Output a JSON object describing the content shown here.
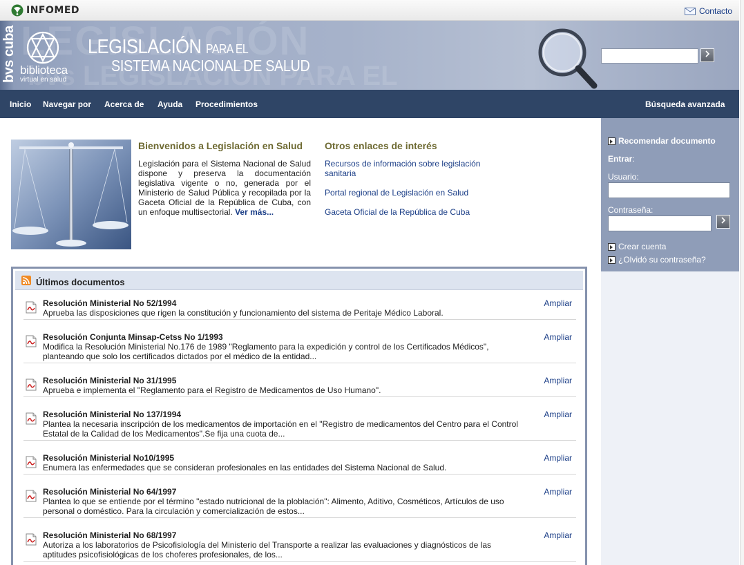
{
  "topbar": {
    "brand": "INFOMED",
    "contact_label": "Contacto"
  },
  "banner": {
    "bvs_label": "bvs cuba",
    "library_name": "biblioteca",
    "library_sub": "virtual en salud",
    "title_main": "LEGISLACIÓN",
    "title_small": "PARA EL",
    "title_sub": "SISTEMA NACIONAL DE SALUD",
    "search_value": ""
  },
  "nav": {
    "items": [
      "Inicio",
      "Navegar por",
      "Acerca de",
      "Ayuda",
      "Procedimientos"
    ],
    "advanced_search": "Búsqueda avanzada"
  },
  "sidebar": {
    "recommend": "Recomendar documento",
    "login_title": "Entrar",
    "user_label": "Usuario:",
    "user_value": "",
    "password_label": "Contraseña:",
    "password_value": "",
    "create_account": "Crear cuenta",
    "forgot_password": "¿Olvidó su contraseña?"
  },
  "intro": {
    "welcome_title": "Bienvenidos a Legislación en Salud",
    "welcome_text": "Legislación para el Sistema Nacional de Salud dispone y preserva la documentación legislativa vigente o no, generada por el Ministerio de Salud Pública y recopilada por la Gaceta Oficial de la República de Cuba, con un enfoque multisectorial.",
    "welcome_more": "Ver más...",
    "links_title": "Otros enlaces de interés",
    "links": [
      "Recursos de información sobre legislación sanitaria",
      "Portal regional de Legislación en Salud",
      "Gaceta Oficial de la República de Cuba"
    ]
  },
  "documents": {
    "header": "Últimos documentos",
    "more_label": "Ampliar",
    "items": [
      {
        "title": "Resolución Ministerial No 52/1994",
        "desc": "Aprueba las disposiciones que rigen la constitución y funcionamiento del sistema de Peritaje Médico Laboral."
      },
      {
        "title": "Resolución Conjunta Minsap-Cetss No 1/1993",
        "desc": "Modifica la Resolución Ministerial No.176 de 1989 \"Reglamento para la expedición y control de los Certificados Médicos\", planteando que solo los certificados dictados por el médico de la entidad..."
      },
      {
        "title": "Resolución Ministerial No 31/1995",
        "desc": "Aprueba e implementa el \"Reglamento para el Registro de Medicamentos de Uso Humano\"."
      },
      {
        "title": "Resolución Ministerial No 137/1994",
        "desc": "Plantea la necesaria inscripción de los medicamentos de importación en el \"Registro de medicamentos del Centro para el Control Estatal de la Calidad de los Medicamentos\".Se fija una cuota de..."
      },
      {
        "title": "Resolución Ministerial No10/1995",
        "desc": "Enumera las enfermedades que se consideran profesionales en las entidades del Sistema Nacional de Salud."
      },
      {
        "title": "Resolución Ministerial No 64/1997",
        "desc": "Plantea lo que se entiende por el término \"estado nutricional de la ploblación\": Alimento, Aditivo, Cosméticos, Artículos de uso personal o doméstico. Para la circulación y comercialización de estos..."
      },
      {
        "title": "Resolución Ministerial No 68/1997",
        "desc": "Autoriza a los laboratorios de Psicofisiología del Ministerio del Transporte a realizar las evaluaciones y diagnósticos de las aptitudes psicofisiológicas de los choferes profesionales, de los..."
      }
    ]
  }
}
